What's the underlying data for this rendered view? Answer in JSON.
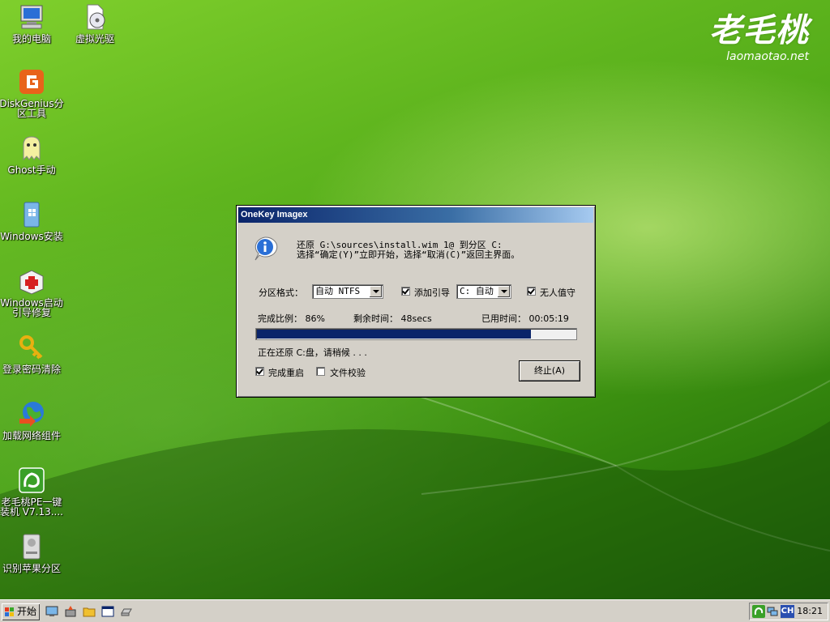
{
  "desktop": {
    "icons": [
      {
        "label": "我的电脑",
        "icon": "computer-icon"
      },
      {
        "label": "虚拟光驱",
        "icon": "virtual-drive-icon"
      },
      {
        "label": "DiskGenius分区工具",
        "icon": "diskgenius-icon"
      },
      {
        "label": "Ghost手动",
        "icon": "ghost-icon"
      },
      {
        "label": "Windows安装",
        "icon": "windows-install-icon"
      },
      {
        "label": "Windows启动引导修复",
        "icon": "boot-repair-icon"
      },
      {
        "label": "登录密码清除",
        "icon": "key-icon"
      },
      {
        "label": "加载网络组件",
        "icon": "network-globe-icon"
      },
      {
        "label": "老毛桃PE一键装机 V7.13....",
        "icon": "pe-install-icon"
      },
      {
        "label": "识别苹果分区",
        "icon": "apple-partition-icon"
      }
    ],
    "logo": {
      "script": "老毛桃",
      "url": "laomaotao.net"
    }
  },
  "dialog": {
    "title": "OneKey Imagex",
    "message_line1": "还原 G:\\sources\\install.wim 1@ 到分区 C:",
    "message_line2": "选择“确定(Y)”立即开始，选择“取消(C)”返回主界面。",
    "format_label": "分区格式：",
    "format_value": "自动 NTFS",
    "boot_label": "添加引导",
    "boot_checked": true,
    "boot_value": "C: 自动",
    "unattended_label": "无人值守",
    "unattended_checked": true,
    "percent_text": "完成比例： 86%",
    "remaining_text": "剩余时间： 48secs",
    "elapsed_text": "已用时间： 00:05:19",
    "progress": 0.86,
    "status_text": "正在还原 C:盘，请稍候 . . .",
    "reboot_label": "完成重启",
    "reboot_checked": true,
    "verify_label": "文件校验",
    "verify_checked": false,
    "stop_button": "终止(A)"
  },
  "taskbar": {
    "start_label": "开始",
    "tray_lang": "CH",
    "clock": "18:21"
  }
}
